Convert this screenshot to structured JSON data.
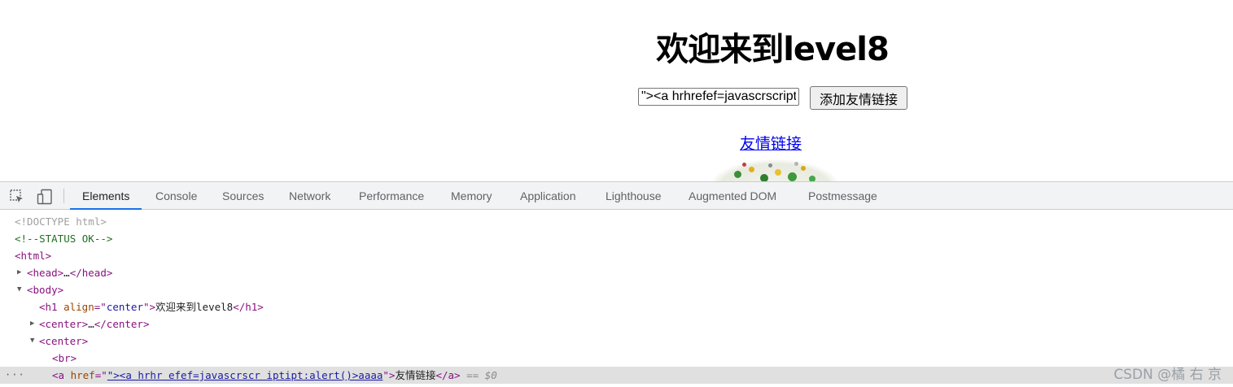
{
  "page": {
    "heading": "欢迎来到level8",
    "input_value": "\"><a hrhrefef=javascrscript",
    "submit_button": "添加友情链接",
    "friend_link": "友情链接"
  },
  "devtools": {
    "tabs": [
      "Elements",
      "Console",
      "Sources",
      "Network",
      "Performance",
      "Memory",
      "Application",
      "Lighthouse",
      "Augmented DOM",
      "Postmessage"
    ],
    "active_tab": "Elements",
    "icons": {
      "inspect": "inspect-element-icon",
      "device": "device-toolbar-icon",
      "more": "more-dots-icon"
    },
    "dom": {
      "doctype": "<!DOCTYPE html>",
      "comment": "<!--STATUS OK-->",
      "html_open": "<html>",
      "head_open": "<head>",
      "head_ellipsis": "…",
      "head_close": "</head>",
      "body_open": "<body>",
      "h1_open": "<h1 ",
      "h1_attr_name": "align",
      "h1_eq": "=\"",
      "h1_attr_value": "center",
      "h1_tag_end": "\">",
      "h1_text": "欢迎来到level8",
      "h1_close": "</h1>",
      "center_open": "<center>",
      "center_ellipsis": "…",
      "center_close": "</center>",
      "center2_open": "<center>",
      "br": "<br>",
      "a_open": "<a ",
      "a_attr_name": "href",
      "a_eq": "=\"",
      "a_attr_value": "\"><a hrhr efef=javascrscr iptipt:alert()>aaaa",
      "a_tag_end": "\">",
      "a_text": "友情链接",
      "a_close": "</a>",
      "selected_marker": "== $0"
    }
  },
  "watermark": "CSDN @橘  右 京"
}
